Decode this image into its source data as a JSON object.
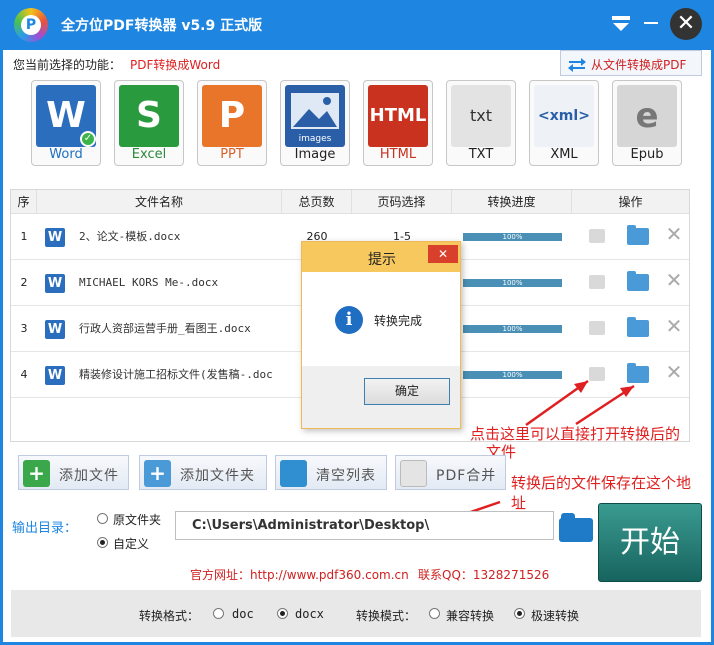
{
  "window": {
    "title": "全方位PDF转换器 v5.9 正式版",
    "logo_letter": "P"
  },
  "function": {
    "label": "您当前选择的功能：",
    "value": "PDF转换成Word"
  },
  "reverse_button": {
    "label": "从文件转换成PDF"
  },
  "formats": [
    {
      "label": "Word",
      "glyph": "W",
      "color": "#2a6ebd"
    },
    {
      "label": "Excel",
      "glyph": "S",
      "color": "#2a9a3e"
    },
    {
      "label": "PPT",
      "glyph": "P",
      "color": "#e8752a"
    },
    {
      "label": "Image",
      "glyph": "images",
      "color": "#2a5fa8"
    },
    {
      "label": "HTML",
      "glyph": "HTML",
      "color": "#c8321e"
    },
    {
      "label": "TXT",
      "glyph": "txt",
      "color": "#d9d9d9"
    },
    {
      "label": "XML",
      "glyph": "<xml>",
      "color": "#e9eef4"
    },
    {
      "label": "Epub",
      "glyph": "e",
      "color": "#8a8a8a"
    }
  ],
  "table": {
    "headers": [
      "序",
      "文件名称",
      "总页数",
      "页码选择",
      "转换进度",
      "操作"
    ],
    "rows": [
      {
        "index": "1",
        "name": "2、论文-模板.docx",
        "pages": "260",
        "range": "1-5",
        "progress": "100%"
      },
      {
        "index": "2",
        "name": "MICHAEL KORS Me-.docx",
        "pages": "",
        "range": "",
        "progress": "100%"
      },
      {
        "index": "3",
        "name": "行政人资部运营手册_看图王.docx",
        "pages": "",
        "range": "",
        "progress": "100%"
      },
      {
        "index": "4",
        "name": "精装修设计施工招标文件(发售稿-.doc",
        "pages": "",
        "range": "",
        "progress": "100%"
      }
    ]
  },
  "dialog": {
    "title": "提示",
    "close": "✕",
    "message": "转换完成",
    "ok": "确定"
  },
  "annotations": {
    "open": "点击这里可以直接打开转换后的文件",
    "open_line1": "点击这里可以直接打开转换后的",
    "open_line2": "文件",
    "saved_line1": "转换后的文件保存在这个地",
    "saved_line2": "址"
  },
  "actions": {
    "add_file": "添加文件",
    "add_folder": "添加文件夹",
    "clear_list": "清空列表",
    "merge": "PDF合并"
  },
  "output": {
    "label": "输出目录：",
    "option_original": "原文件夹",
    "option_custom": "自定义",
    "selected": "自定义",
    "path": "C:\\Users\\Administrator\\Desktop\\"
  },
  "start_button": "开始",
  "footer": {
    "site": "官方网址：http://www.pdf360.com.cn",
    "qq": "联系QQ：1328271526"
  },
  "bottom_bar": {
    "format_label": "转换格式：",
    "format_doc": "doc",
    "format_docx": "docx",
    "format_selected": "docx",
    "mode_label": "转换模式：",
    "mode_compat": "兼容转换",
    "mode_fast": "极速转换",
    "mode_selected": "极速转换"
  },
  "colors": {
    "accent": "#1e86e0",
    "annotation": "#e02020",
    "start": "#1f7a72"
  }
}
